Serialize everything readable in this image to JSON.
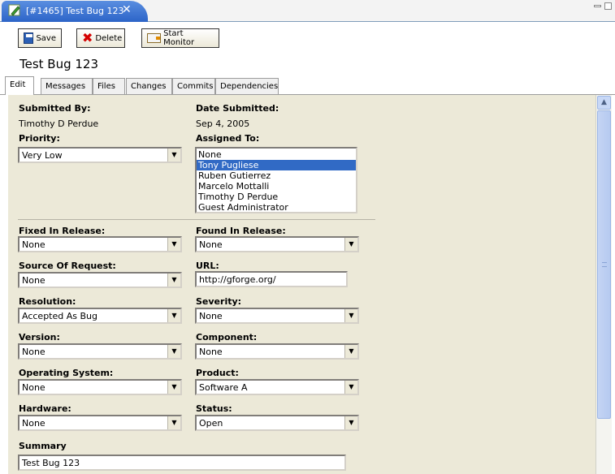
{
  "editor_tab": {
    "title": "[#1465] Test Bug 123",
    "close": "✕"
  },
  "toolbar": {
    "save_label": "Save",
    "delete_label": "Delete",
    "monitor_label": "Start Monitor"
  },
  "page_title": "Test Bug 123",
  "tabs": [
    "Edit",
    "Messages",
    "Files",
    "Changes",
    "Commits",
    "Dependencies"
  ],
  "form": {
    "submitted_by_label": "Submitted By:",
    "submitted_by": "Timothy D Perdue",
    "date_submitted_label": "Date Submitted:",
    "date_submitted": "Sep 4, 2005",
    "priority_label": "Priority:",
    "priority": "Very Low",
    "assigned_to_label": "Assigned To:",
    "assigned_to_options": [
      "None",
      "Tony Pugliese",
      "Ruben Gutierrez",
      "Marcelo Mottalli",
      "Timothy D Perdue",
      "Guest  Administrator"
    ],
    "assigned_to_selected": "Tony Pugliese",
    "fixed_in_release_label": "Fixed In Release:",
    "fixed_in_release": "None",
    "found_in_release_label": "Found In Release:",
    "found_in_release": "None",
    "source_of_request_label": "Source Of Request:",
    "source_of_request": "None",
    "url_label": "URL:",
    "url": "http://gforge.org/",
    "resolution_label": "Resolution:",
    "resolution": "Accepted As Bug",
    "severity_label": "Severity:",
    "severity": "None",
    "version_label": "Version:",
    "version": "None",
    "component_label": "Component:",
    "component": "None",
    "operating_system_label": "Operating System:",
    "operating_system": "None",
    "product_label": "Product:",
    "product": "Software A",
    "hardware_label": "Hardware:",
    "hardware": "None",
    "status_label": "Status:",
    "status": "Open",
    "summary_label": "Summary",
    "summary": "Test Bug 123"
  },
  "icons": {
    "tab_icon": "pencil-icon",
    "save": "save-icon",
    "delete": "delete-icon",
    "monitor": "monitor-icon",
    "dropdown": "chevron-down-icon",
    "scroll_up": "scroll-up-icon"
  },
  "colors": {
    "tab_active": "#2c64c8",
    "panel_bg": "#ece9d8",
    "selection": "#316ac5"
  }
}
